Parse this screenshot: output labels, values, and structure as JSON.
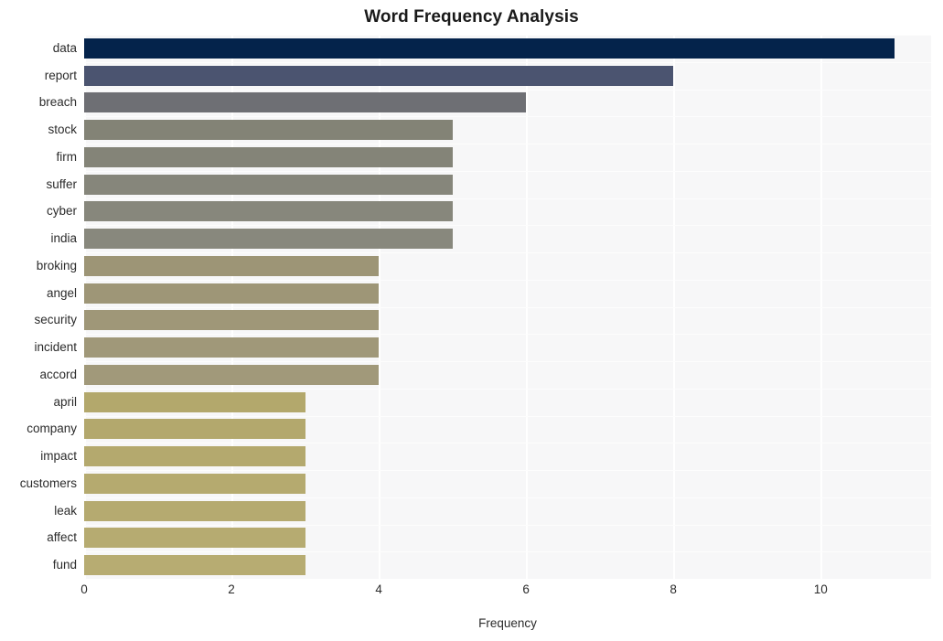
{
  "chart_data": {
    "type": "bar",
    "orientation": "horizontal",
    "title": "Word Frequency Analysis",
    "xlabel": "Frequency",
    "ylabel": "",
    "xlim": [
      0,
      11.5
    ],
    "xticks": [
      0,
      2,
      4,
      6,
      8,
      10
    ],
    "xtick_labels": [
      "0",
      "2",
      "4",
      "6",
      "8",
      "10"
    ],
    "grid": true,
    "grid_color": "#ffffff",
    "plot_background": "#f7f7f8",
    "figure_background": "#ffffff",
    "legend": null,
    "categories": [
      "data",
      "report",
      "breach",
      "stock",
      "firm",
      "suffer",
      "cyber",
      "india",
      "broking",
      "angel",
      "security",
      "incident",
      "accord",
      "april",
      "company",
      "impact",
      "customers",
      "leak",
      "affect",
      "fund"
    ],
    "values": [
      11,
      8,
      6,
      5,
      5,
      5,
      5,
      5,
      4,
      4,
      4,
      4,
      4,
      3,
      3,
      3,
      3,
      3,
      3,
      3
    ],
    "bar_colors": [
      "#04234b",
      "#4b5470",
      "#6e6f74",
      "#838376",
      "#848478",
      "#86867b",
      "#87877c",
      "#88887d",
      "#9d9576",
      "#9e9677",
      "#9f9778",
      "#a09879",
      "#a1997a",
      "#b3a86c",
      "#b3a86d",
      "#b4a96e",
      "#b5aa6f",
      "#b5aa70",
      "#b6ab71",
      "#b7ac72"
    ],
    "series": [
      {
        "name": "Frequency",
        "values": [
          11,
          8,
          6,
          5,
          5,
          5,
          5,
          5,
          4,
          4,
          4,
          4,
          4,
          3,
          3,
          3,
          3,
          3,
          3,
          3
        ]
      }
    ]
  }
}
